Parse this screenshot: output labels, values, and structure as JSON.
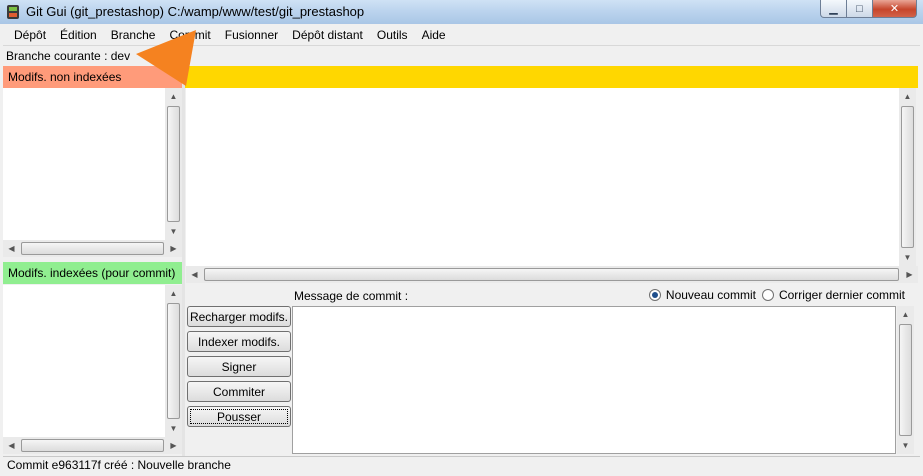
{
  "window": {
    "title": "Git Gui (git_prestashop) C:/wamp/www/test/git_prestashop",
    "buttons": {
      "minimize": "▁",
      "maximize": "□",
      "close": "✕"
    }
  },
  "menu": [
    "Dépôt",
    "Édition",
    "Branche",
    "Commit",
    "Fusionner",
    "Dépôt distant",
    "Outils",
    "Aide"
  ],
  "branch": {
    "label": "Branche courante : dev"
  },
  "panes": {
    "unstaged_title": "Modifs. non indexées",
    "staged_title": "Modifs. indexées (pour commit)"
  },
  "commit": {
    "message_label": "Message de commit :",
    "new_commit": "Nouveau commit",
    "amend_commit": "Corriger dernier commit",
    "selected_mode": "new_commit",
    "buttons": {
      "rescan": "Recharger modifs.",
      "stage": "Indexer modifs.",
      "sign": "Signer",
      "commit": "Commiter",
      "push": "Pousser"
    }
  },
  "status": {
    "text": "Commit e963117f créé : Nouvelle branche"
  },
  "colors": {
    "unstaged_header": "#ff9b7a",
    "diff_header": "#ffd700",
    "staged_header": "#90ee90",
    "annotation_arrow": "#f58220"
  },
  "icons": {
    "app": "git-gui-icon",
    "annotation": "orange-arrow-icon"
  }
}
